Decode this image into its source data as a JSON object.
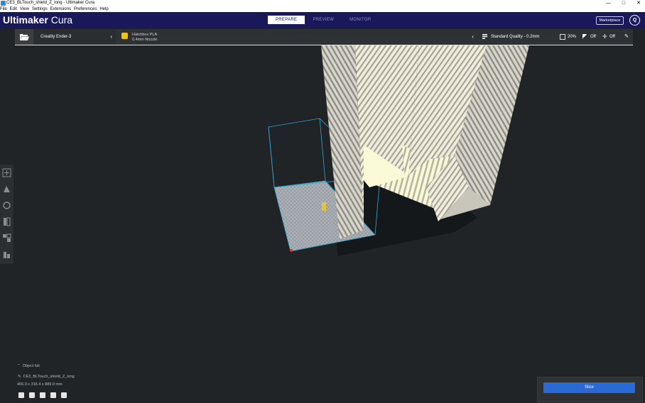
{
  "window": {
    "title": "CE3_BLTouch_shield_Z_long - Ultimaker Cura",
    "minimize": "—",
    "maximize": "□",
    "close": "✕"
  },
  "menu": [
    "File",
    "Edit",
    "View",
    "Settings",
    "Extensions",
    "Preferences",
    "Help"
  ],
  "header": {
    "logo_bold": "Ultimaker",
    "logo_light": " Cura",
    "tabs": [
      "PREPARE",
      "PREVIEW",
      "MONITOR"
    ],
    "active_tab": "PREPARE",
    "marketplace": "Marketplace",
    "account_initial": "Q"
  },
  "settings": {
    "printer": "Creality Ender-3",
    "material_name": "Hatchbox PLA",
    "nozzle": "0.4mm Nozzle",
    "profile": "Standard Quality - 0.2mm",
    "infill": "20%",
    "support": "Off",
    "adhesion": "Off"
  },
  "object_list": {
    "toggle_label": "Object list",
    "object_name": "CE3_BLTouch_shield_Z_long",
    "dimensions": "406.9 x 316.4 x 889.0 mm"
  },
  "slice": {
    "label": "Slice"
  },
  "colors": {
    "header_bg": "#18185a",
    "viewport_bg": "#202426",
    "slice_button": "#2a6ad6",
    "material_color": "#f0c415"
  },
  "icons": {
    "open": "folder-open-icon",
    "material": "material-spool-icon",
    "profile": "quality-profile-icon",
    "infill": "infill-icon",
    "support": "support-icon",
    "adhesion": "adhesion-icon",
    "edit": "pencil-icon"
  }
}
